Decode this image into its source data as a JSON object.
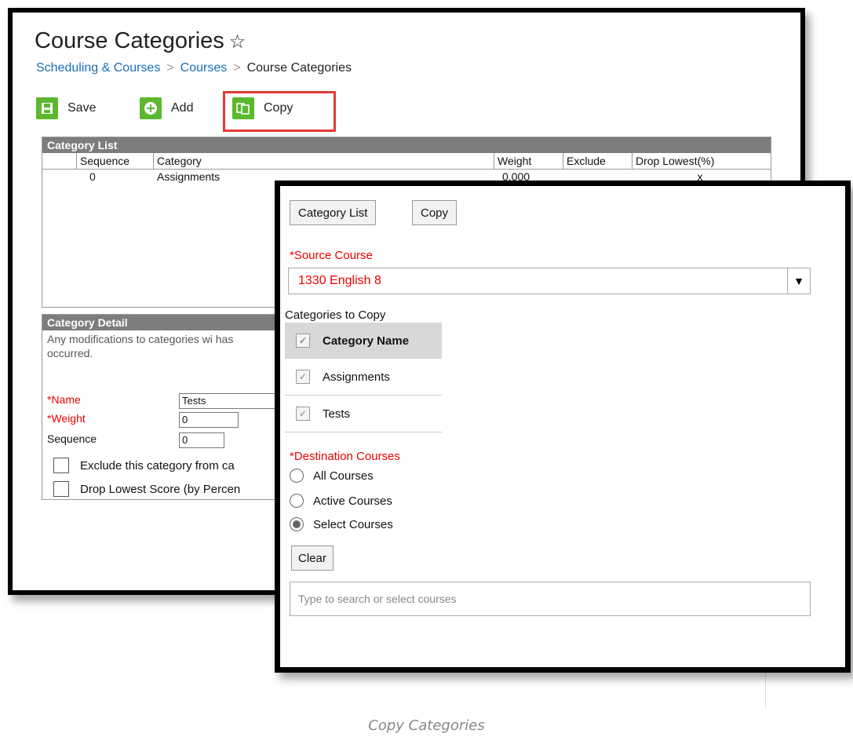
{
  "header": {
    "title": "Course Categories",
    "star": "☆",
    "breadcrumb": [
      "Scheduling & Courses",
      "Courses",
      "Course Categories"
    ],
    "breadcrumb_sep": ">"
  },
  "toolbar": {
    "save_label": "Save",
    "add_label": "Add",
    "copy_label": "Copy"
  },
  "category_list": {
    "title": "Category List",
    "columns": [
      "Sequence",
      "Category",
      "Weight",
      "Exclude",
      "Drop Lowest(%)"
    ],
    "rows": [
      {
        "sequence": "0",
        "category": "Assignments",
        "weight": "0.000",
        "exclude": "",
        "drop_lowest": "x"
      }
    ]
  },
  "category_detail": {
    "title": "Category Detail",
    "note": "Any modifications to categories wi has occurred.",
    "name_label": "*Name",
    "name_value": "Tests",
    "weight_label": "*Weight",
    "weight_value": "0",
    "sequence_label": "Sequence",
    "sequence_value": "0",
    "exclude_label": "Exclude this category from ca",
    "drop_label": "Drop Lowest Score (by Percen"
  },
  "copy_modal": {
    "category_list_btn": "Category List",
    "copy_btn": "Copy",
    "source_label": "*Source Course",
    "source_value": "1330 English 8",
    "categories_label": "Categories to Copy",
    "category_name_header": "Category Name",
    "categories": [
      "Assignments",
      "Tests"
    ],
    "destination_label": "*Destination Courses",
    "destination_options": [
      "All Courses",
      "Active Courses",
      "Select Courses"
    ],
    "selected_destination": "Select Courses",
    "clear_btn": "Clear",
    "search_placeholder": "Type to search or select courses"
  },
  "caption": "Copy Categories",
  "colors": {
    "link": "#1a6fb5",
    "required": "#ee0000",
    "toolbar_icon": "#5cb82e",
    "highlight": "#e53935",
    "panel_header": "#7d7d7d"
  }
}
